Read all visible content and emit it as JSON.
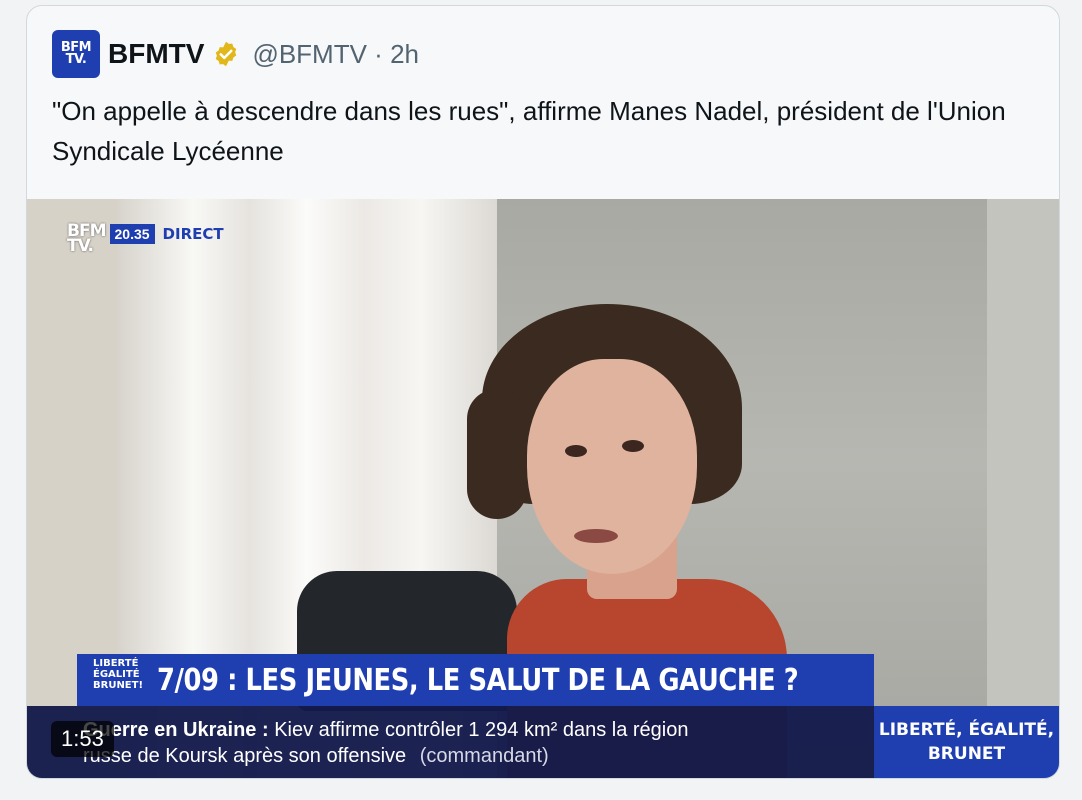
{
  "tweet": {
    "author_name": "BFMTV",
    "author_handle": "@BFMTV",
    "separator": "·",
    "time_ago": "2h",
    "logo_text_line1": "BFM",
    "logo_text_line2": "TV.",
    "text": "\"On appelle à descendre dans les rues\", affirme Manes Nadel, président de l'Union Syndicale Lycéenne"
  },
  "video": {
    "duration": "1:53",
    "bug": {
      "logo_line1": "BFM",
      "logo_line2": "TV.",
      "time": "20.35",
      "live": "DIRECT"
    },
    "show_badge": [
      "LIBERTÉ",
      "ÉGALITÉ",
      "BRUNET!"
    ],
    "headline": "7/09 : LES JEUNES, LE SALUT DE LA GAUCHE ?",
    "ticker": {
      "topic": "Guerre en Ukraine :",
      "line1_text": "Kiev affirme contrôler 1 294 km² dans la région",
      "line2_text": "russe de Koursk après son offensive",
      "source": "(commandant)"
    },
    "side_box": [
      "LIBERTÉ, ÉGALITÉ,",
      "BRUNET"
    ]
  },
  "colors": {
    "bfm_blue": "#1f3fb1",
    "verified_gold": "#e2b719",
    "ticker_bg": "#131a4b"
  }
}
